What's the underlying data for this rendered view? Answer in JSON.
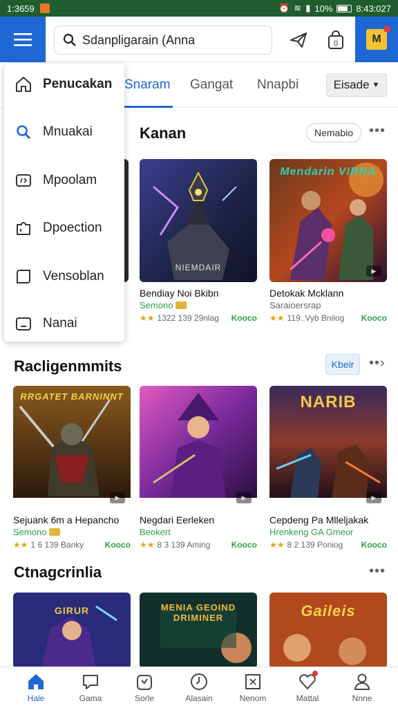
{
  "status_bar": {
    "time_left": "1:3659",
    "battery": "10%",
    "time_right": "8:43:027"
  },
  "search": {
    "value": "Sdanpligarain (Anna"
  },
  "tabs": [
    {
      "label": "Snaram",
      "active": true
    },
    {
      "label": "Gangat",
      "active": false
    },
    {
      "label": "Nnapbi",
      "active": false
    }
  ],
  "tab_select": {
    "value": "Eisade"
  },
  "drawer": {
    "items": [
      {
        "label": "Penucakan",
        "icon": "home-icon"
      },
      {
        "label": "Mnuakai",
        "icon": "search-icon"
      },
      {
        "label": "Mpoolam",
        "icon": "tag-icon"
      },
      {
        "label": "Dpoection",
        "icon": "puzzle-icon"
      },
      {
        "label": "Vensoblan",
        "icon": "box-icon"
      },
      {
        "label": "Nanai",
        "icon": "window-icon"
      }
    ]
  },
  "sections": [
    {
      "title": "Kanan",
      "pill": "Nemabio",
      "cards": [
        {
          "title": "Bendiay Noi Bkibn",
          "sub": "Semono",
          "meta": "1322 139 29nlag",
          "get": "Kooco",
          "caption": "NIEMDAIR"
        },
        {
          "title": "Detokak Mcklann",
          "sub": "Saraioersrap",
          "meta": "119..Vyb Bnilog",
          "get": "Kooco",
          "caption": "Mendarin VIRNA"
        }
      ]
    },
    {
      "title": "Racligenmmits",
      "pill": "Kbeir",
      "cards": [
        {
          "title": "Sejuank 6m a Hepancho",
          "sub": "Semono",
          "meta": "1 6 139 Banky",
          "get": "Kooco",
          "caption": "RRGATET BARNINNT"
        },
        {
          "title": "Negdari Eerleken",
          "sub": "Beokert",
          "meta": "8 3 139 Aming",
          "get": "Kooco",
          "caption": ""
        },
        {
          "title": "Cepdeng Pa Mlleljakak",
          "sub": "Hrenkeng GA Gmeor",
          "meta": "8 2 139 Poniog",
          "get": "Kooco",
          "caption": "NARIB"
        }
      ]
    },
    {
      "title": "Ctnagcrinlia",
      "cards": [
        {
          "caption": "GIRUR"
        },
        {
          "caption": "MENIA GEOIND DRIMINER"
        },
        {
          "caption": "Gaileis"
        }
      ]
    }
  ],
  "bottom_nav": [
    {
      "label": "Hale",
      "icon": "home-icon",
      "active": true
    },
    {
      "label": "Gama",
      "icon": "chat-icon"
    },
    {
      "label": "Sorle",
      "icon": "calendar-icon"
    },
    {
      "label": "Alasain",
      "icon": "clock-icon"
    },
    {
      "label": "Nenom",
      "icon": "grid-icon"
    },
    {
      "label": "Mattal",
      "icon": "heart-icon",
      "badge": true
    },
    {
      "label": "Nnne",
      "icon": "user-icon"
    }
  ],
  "colors": {
    "accent": "#1e68d6",
    "green": "#2e9e4a",
    "statusbar": "#1f5d2e"
  }
}
